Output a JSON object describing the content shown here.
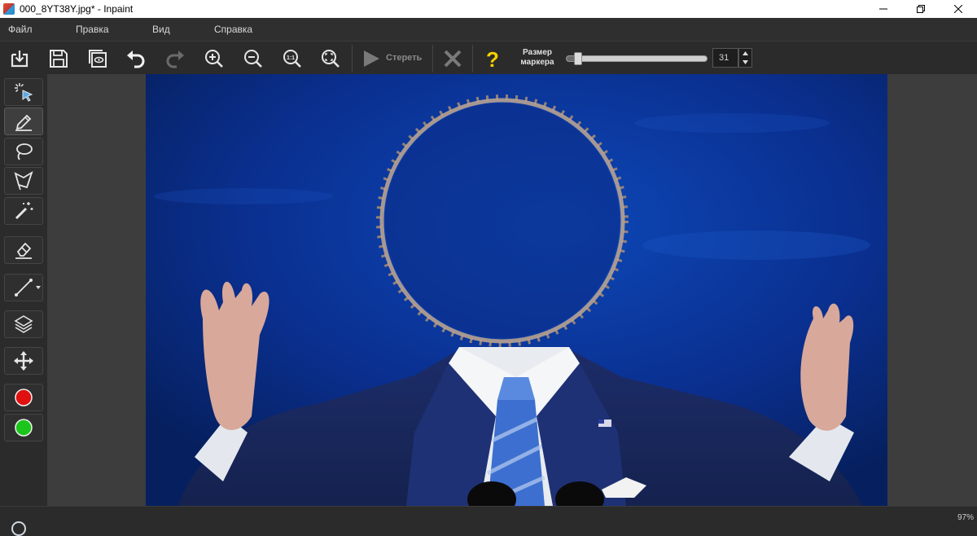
{
  "window": {
    "title": "000_8YT38Y.jpg* - Inpaint"
  },
  "menu": {
    "items": [
      "Файл",
      "Правка",
      "Вид",
      "Справка"
    ]
  },
  "toolbar": {
    "buttons": [
      "open-icon",
      "save-icon",
      "preview-icon",
      "undo-icon",
      "redo-icon",
      "zoom-in-icon",
      "zoom-out-icon",
      "zoom-actual-size-icon",
      "zoom-fit-icon",
      "play-icon",
      "close-icon",
      "help-icon"
    ],
    "erase_label": "Стереть",
    "marker_size_label_line1": "Размер",
    "marker_size_label_line2": "маркера",
    "marker_size_value": "31",
    "marker_slider_fraction": 0.05
  },
  "toolbox": {
    "tools": [
      "smart-select-icon",
      "marker-icon",
      "lasso-icon",
      "polygonal-lasso-icon",
      "magic-wand-icon",
      "eraser-icon",
      "line-icon",
      "layers-icon",
      "move-icon",
      "red-color-icon",
      "green-color-icon"
    ],
    "active_tool": "marker-icon",
    "colors": {
      "red": "#e01010",
      "green": "#1cc41c"
    }
  },
  "status": {
    "zoom": "97%"
  },
  "colors": {
    "accent_yellow": "#f5d000",
    "canvas_bg": "#3d3d3d",
    "image_blue": "#0a2f8f"
  }
}
